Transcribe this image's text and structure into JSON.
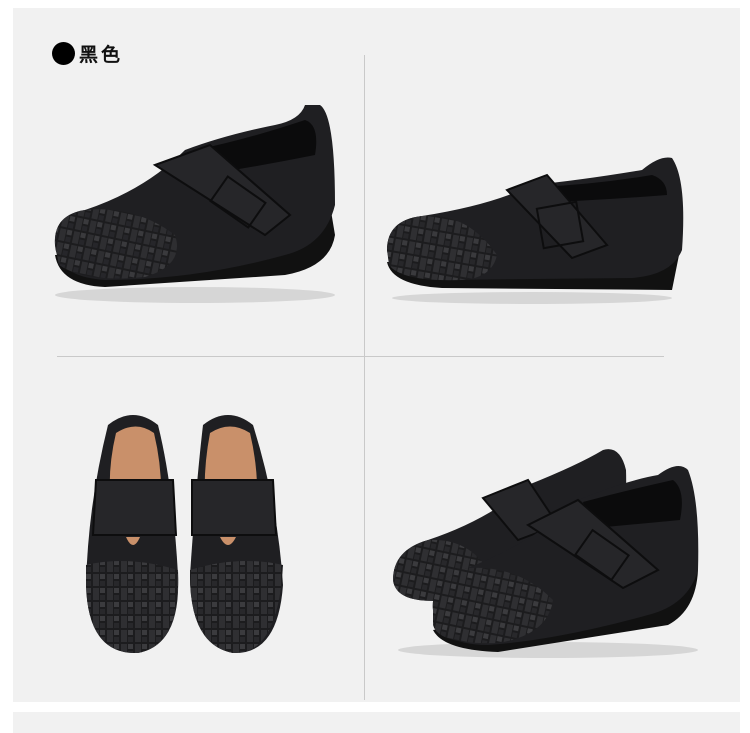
{
  "header": {
    "color_label": "黑色",
    "dot_icon": "filled-circle-icon",
    "swatch_color": "#000000"
  },
  "photos": [
    {
      "view": "side-angled-left",
      "icon": "shoe-photo"
    },
    {
      "view": "side-profile-right",
      "icon": "shoe-photo"
    },
    {
      "view": "top-down-pair",
      "icon": "shoe-photo"
    },
    {
      "view": "pair-angled-right",
      "icon": "shoe-photo"
    }
  ],
  "colors": {
    "background": "#f1f1f1",
    "shoe": "#1a1a1c",
    "lining": "#c9906a"
  }
}
